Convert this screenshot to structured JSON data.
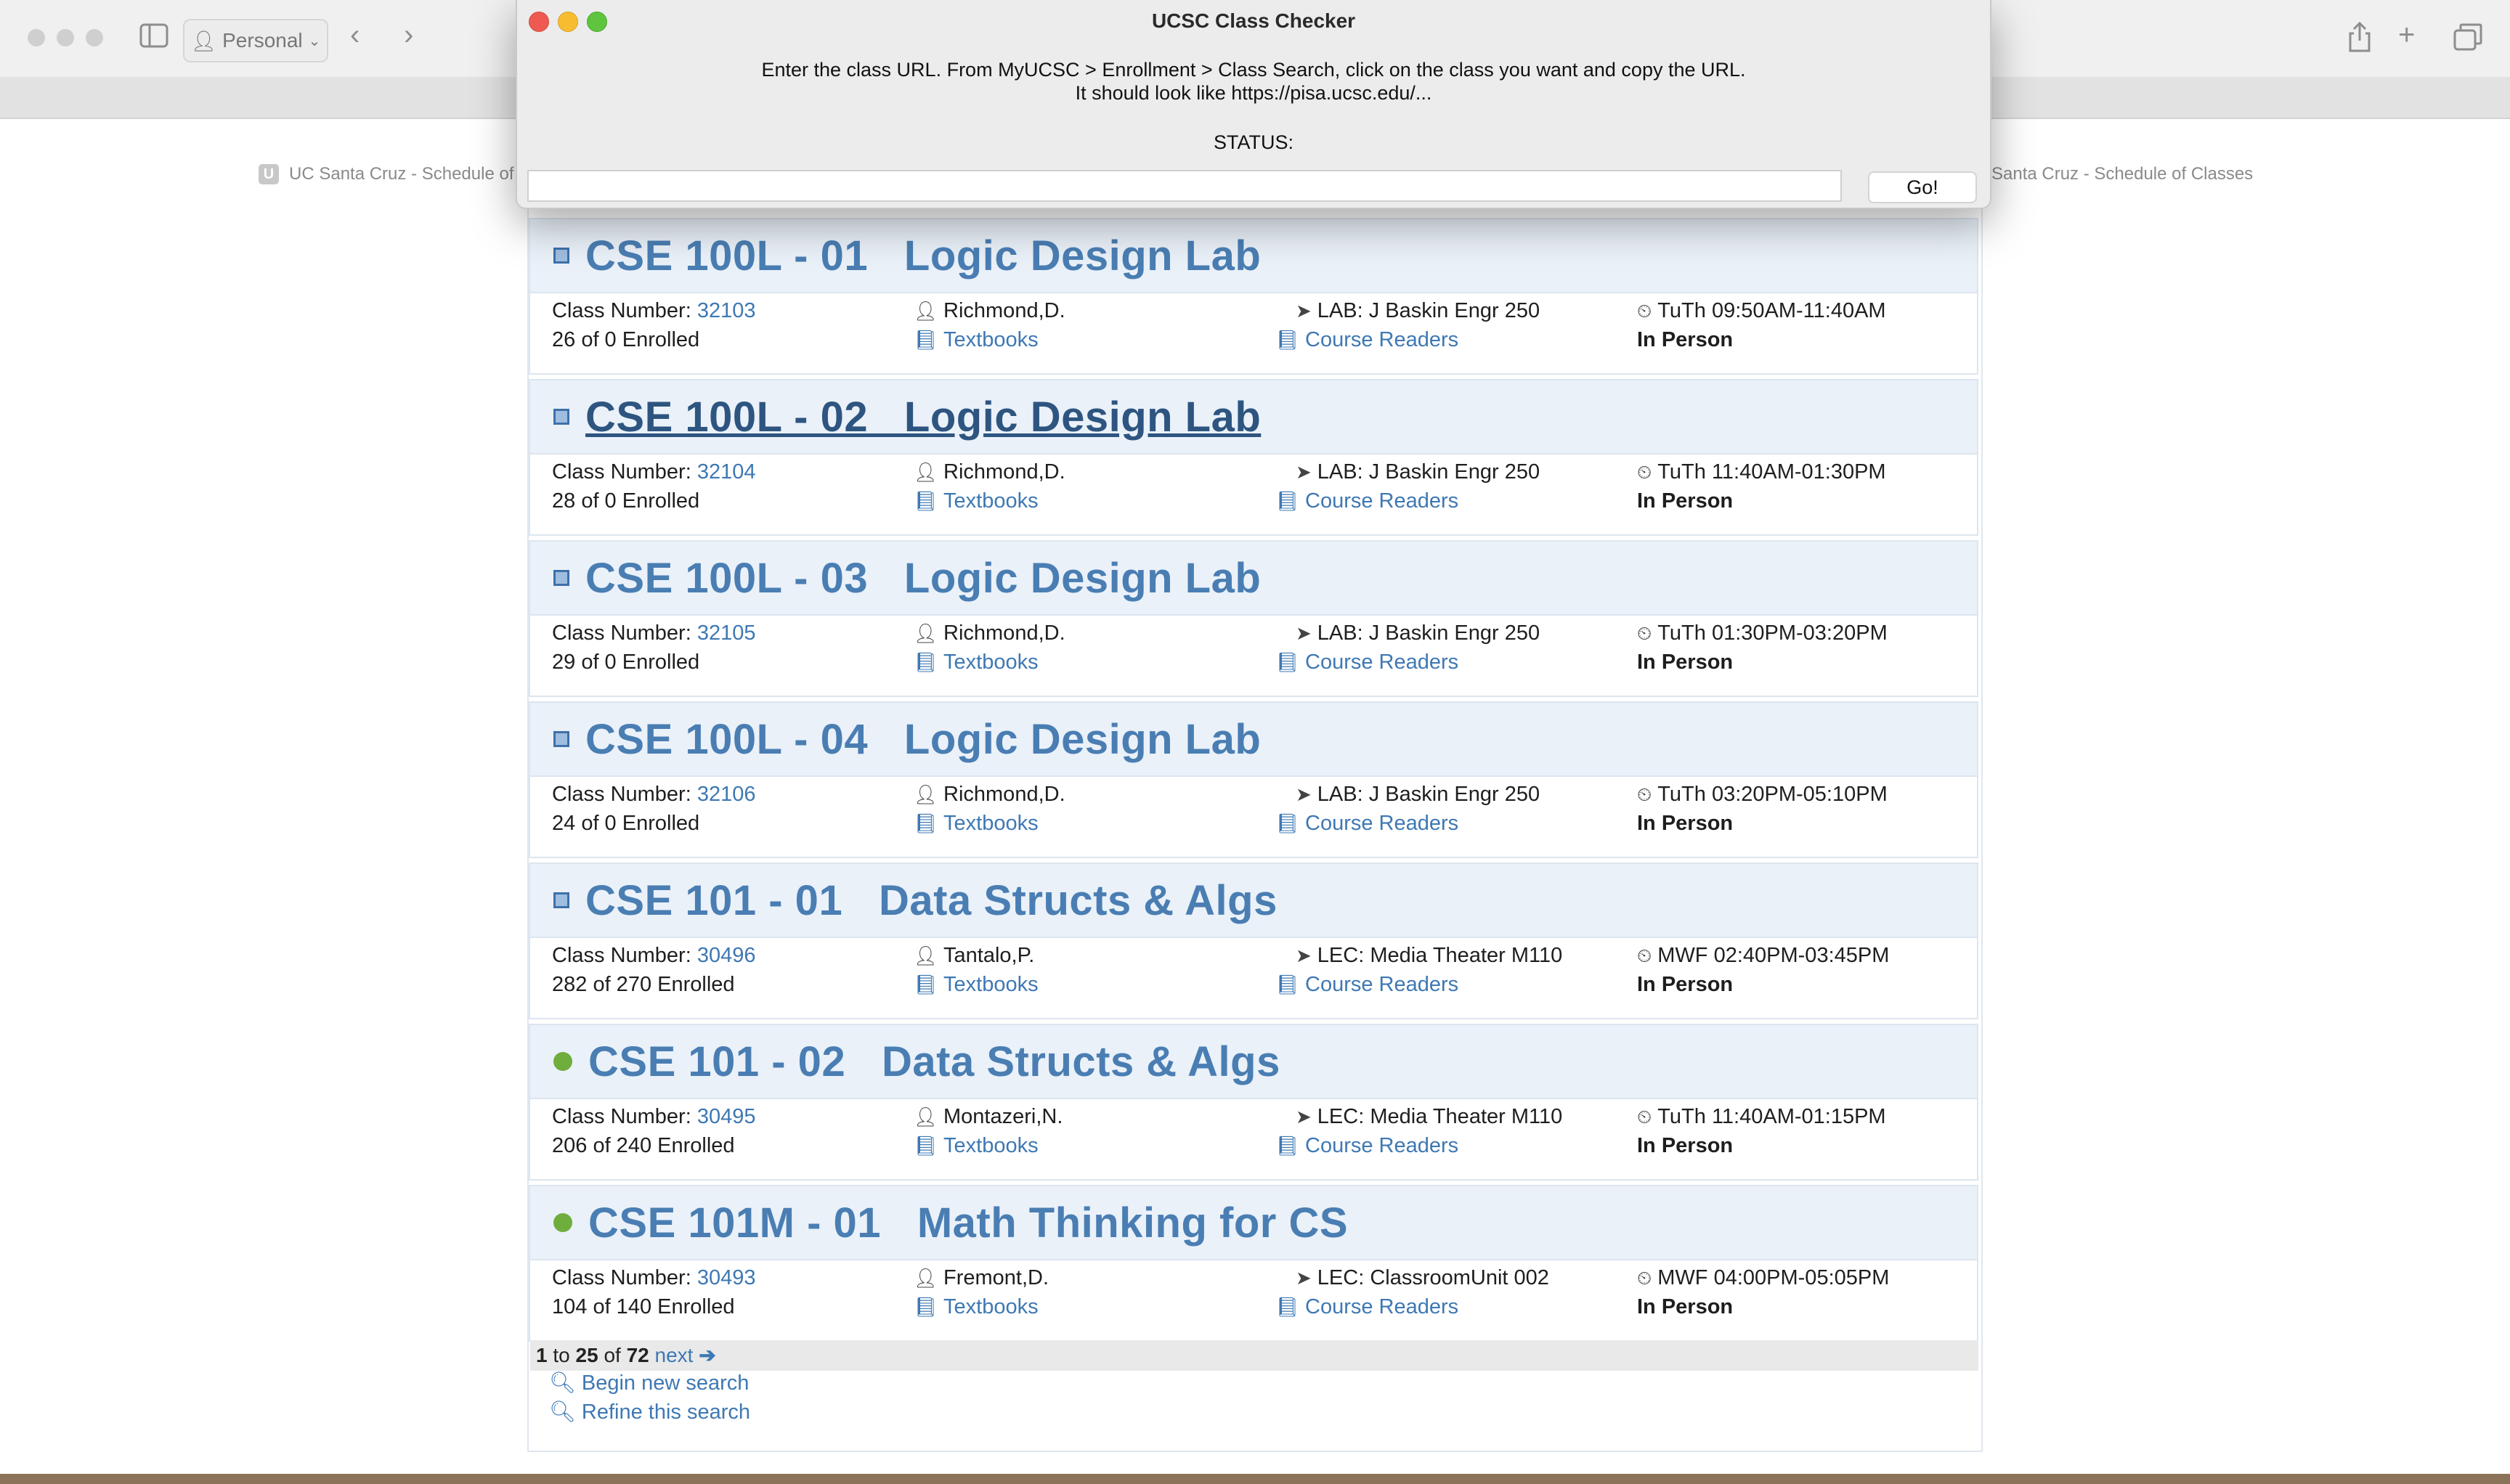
{
  "browser": {
    "profile_label": "Personal",
    "tab_left_title": "UC Santa Cruz - Schedule of",
    "tab_left_favicon": "U",
    "tab_right_title": "Santa Cruz - Schedule of Classes"
  },
  "dialog": {
    "title": "UCSC Class Checker",
    "instruction_line1": "Enter the class URL. From MyUCSC > Enrollment > Class Search, click on the class you want and copy the URL.",
    "instruction_line2": "It should look like https://pisa.ucsc.edu/...",
    "status_label": "STATUS:",
    "url_value": "",
    "go_label": "Go!"
  },
  "labels": {
    "class_number": "Class Number: ",
    "textbooks": "Textbooks",
    "course_readers": "Course Readers",
    "mode": "In Person"
  },
  "courses": [
    {
      "title": "CSE 100L - 01   Logic Design Lab",
      "status": "waitlist",
      "class_number": "32103",
      "enrolled": "26 of 0 Enrolled",
      "instructor": "Richmond,D.",
      "location": "LAB: J Baskin Engr 250",
      "time": "TuTh 09:50AM-11:40AM"
    },
    {
      "title": "CSE 100L - 02   Logic Design Lab",
      "status": "waitlist",
      "class_number": "32104",
      "enrolled": "28 of 0 Enrolled",
      "instructor": "Richmond,D.",
      "location": "LAB: J Baskin Engr 250",
      "time": "TuTh 11:40AM-01:30PM"
    },
    {
      "title": "CSE 100L - 03   Logic Design Lab",
      "status": "waitlist",
      "class_number": "32105",
      "enrolled": "29 of 0 Enrolled",
      "instructor": "Richmond,D.",
      "location": "LAB: J Baskin Engr 250",
      "time": "TuTh 01:30PM-03:20PM"
    },
    {
      "title": "CSE 100L - 04   Logic Design Lab",
      "status": "waitlist",
      "class_number": "32106",
      "enrolled": "24 of 0 Enrolled",
      "instructor": "Richmond,D.",
      "location": "LAB: J Baskin Engr 250",
      "time": "TuTh 03:20PM-05:10PM"
    },
    {
      "title": "CSE 101 - 01   Data Structs & Algs",
      "status": "waitlist",
      "class_number": "30496",
      "enrolled": "282 of 270 Enrolled",
      "instructor": "Tantalo,P.",
      "location": "LEC: Media Theater M110",
      "time": "MWF 02:40PM-03:45PM"
    },
    {
      "title": "CSE 101 - 02   Data Structs & Algs",
      "status": "open",
      "class_number": "30495",
      "enrolled": "206 of 240 Enrolled",
      "instructor": "Montazeri,N.",
      "location": "LEC: Media Theater M110",
      "time": "TuTh 11:40AM-01:15PM"
    },
    {
      "title": "CSE 101M - 01   Math Thinking for CS",
      "status": "open",
      "class_number": "30493",
      "enrolled": "104 of 140 Enrolled",
      "instructor": "Fremont,D.",
      "location": "LEC: ClassroomUnit 002",
      "time": "MWF 04:00PM-05:05PM"
    }
  ],
  "pager": {
    "from": "1",
    "to_word": "to",
    "to": "25",
    "of_word": "of",
    "total": "72",
    "next_label": "next"
  },
  "search_links": {
    "begin_new": "Begin new search",
    "refine": "Refine this search"
  }
}
